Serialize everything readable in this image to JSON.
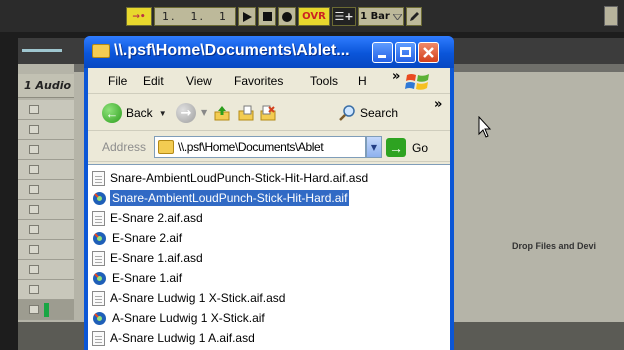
{
  "daw": {
    "transport": {
      "follow_label": "→•",
      "position": [
        "1.",
        "1.",
        "1"
      ],
      "ovr_label": "OVR",
      "quantize_label": "1 Bar",
      "overdub_glyph": "☰+"
    },
    "track_name": "1 Audio",
    "drop_hint": "Drop Files and Devi"
  },
  "explorer": {
    "title": "\\\\.psf\\Home\\Documents\\Ablet...",
    "menu": [
      "File",
      "Edit",
      "View",
      "Favorites",
      "Tools",
      "H"
    ],
    "menu_overflow": "»",
    "toolbar": {
      "back_label": "Back",
      "search_label": "Search",
      "overflow": "»"
    },
    "address": {
      "label": "Address",
      "value": "\\\\.psf\\Home\\Documents\\Ablet",
      "go_label": "Go"
    },
    "files": [
      {
        "name": "Snare-AmbientLoudPunch-Stick-Hit-Hard.aif.asd",
        "type": "doc"
      },
      {
        "name": "Snare-AmbientLoudPunch-Stick-Hit-Hard.aif",
        "type": "audio",
        "selected": true
      },
      {
        "name": "E-Snare 2.aif.asd",
        "type": "doc"
      },
      {
        "name": "E-Snare 2.aif",
        "type": "audio"
      },
      {
        "name": "E-Snare 1.aif.asd",
        "type": "doc"
      },
      {
        "name": "E-Snare 1.aif",
        "type": "audio"
      },
      {
        "name": "A-Snare Ludwig 1 X-Stick.aif.asd",
        "type": "doc"
      },
      {
        "name": "A-Snare Ludwig 1 X-Stick.aif",
        "type": "audio"
      },
      {
        "name": "A-Snare Ludwig 1 A.aif.asd",
        "type": "doc"
      }
    ]
  },
  "colors": {
    "xp_title_blue": "#0a55d9",
    "selection_blue": "#316ac5",
    "transport_yellow": "#e8d82d",
    "daw_panel": "#b5b4a8",
    "meter_green": "#19a644"
  }
}
